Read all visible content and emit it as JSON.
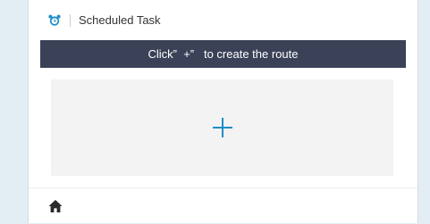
{
  "header": {
    "title": "Scheduled Task",
    "icon": "alarm-clock-icon"
  },
  "banner": {
    "text": "Click”  +”   to create the route"
  },
  "add_area": {
    "icon": "plus-icon",
    "accent_color": "#1e8fc8"
  },
  "footer": {
    "home_icon": "home-icon"
  }
}
